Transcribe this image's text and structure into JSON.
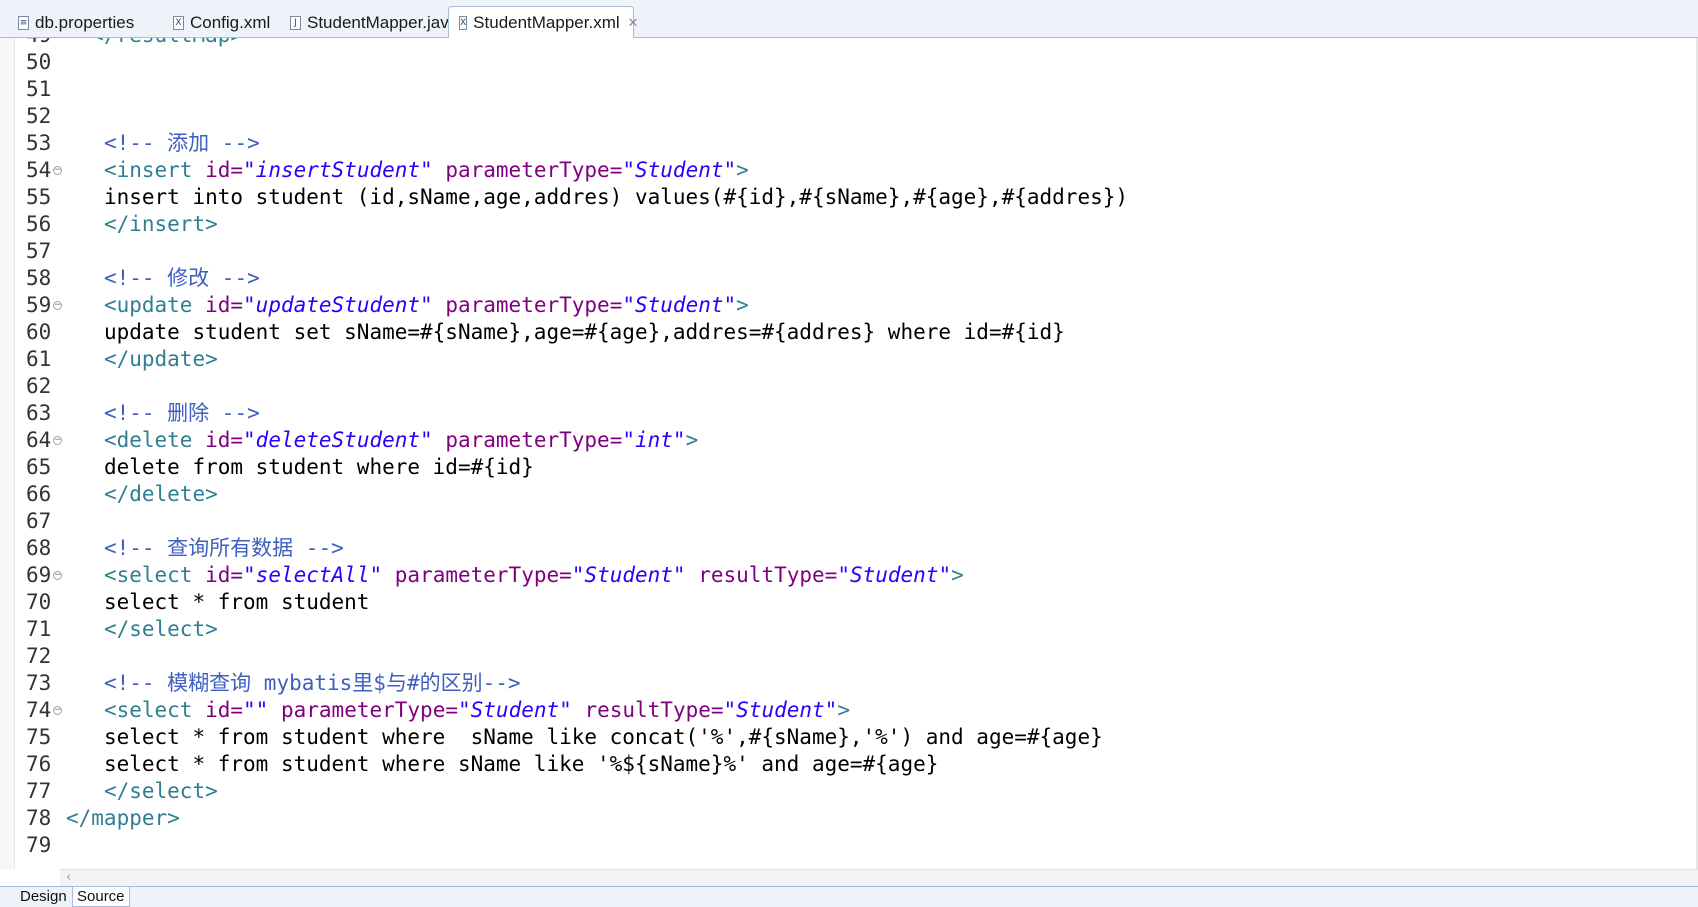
{
  "tabs": [
    {
      "label": "db.properties",
      "icon": "properties-file-icon"
    },
    {
      "label": "Config.xml",
      "icon": "xml-file-icon"
    },
    {
      "label": "StudentMapper.java",
      "icon": "java-file-icon"
    },
    {
      "label": "StudentMapper.xml",
      "icon": "xml-file-icon",
      "active": true,
      "close": "✕"
    }
  ],
  "editor": {
    "lines": [
      {
        "n": "49",
        "fold": false,
        "tokens": [
          [
            "t",
            "</resultMap>"
          ]
        ],
        "indent": 2
      },
      {
        "n": "50",
        "fold": false,
        "tokens": [],
        "indent": 0
      },
      {
        "n": "51",
        "fold": false,
        "tokens": [],
        "indent": 0
      },
      {
        "n": "52",
        "fold": false,
        "tokens": [],
        "indent": 0
      },
      {
        "n": "53",
        "fold": false,
        "tokens": [
          [
            "c",
            "<!-- 添加 -->"
          ]
        ],
        "indent": 3
      },
      {
        "n": "54",
        "fold": true,
        "tokens": [
          [
            "t",
            "<insert "
          ],
          [
            "a",
            "id="
          ],
          [
            "v",
            "\"insertStudent\""
          ],
          [
            "x",
            " "
          ],
          [
            "a",
            "parameterType="
          ],
          [
            "v",
            "\"Student\""
          ],
          [
            "t",
            ">"
          ]
        ],
        "indent": 3
      },
      {
        "n": "55",
        "fold": false,
        "tokens": [
          [
            "x",
            "insert into student (id,sName,age,addres) values(#{id},#{sName},#{age},#{addres})"
          ]
        ],
        "indent": 3
      },
      {
        "n": "56",
        "fold": false,
        "tokens": [
          [
            "t",
            "</insert>"
          ]
        ],
        "indent": 3
      },
      {
        "n": "57",
        "fold": false,
        "tokens": [],
        "indent": 0
      },
      {
        "n": "58",
        "fold": false,
        "tokens": [
          [
            "c",
            "<!-- 修改 -->"
          ]
        ],
        "indent": 3
      },
      {
        "n": "59",
        "fold": true,
        "tokens": [
          [
            "t",
            "<update "
          ],
          [
            "a",
            "id="
          ],
          [
            "v",
            "\"updateStudent\""
          ],
          [
            "x",
            " "
          ],
          [
            "a",
            "parameterType="
          ],
          [
            "v",
            "\"Student\""
          ],
          [
            "t",
            ">"
          ]
        ],
        "indent": 3
      },
      {
        "n": "60",
        "fold": false,
        "tokens": [
          [
            "x",
            "update student set sName=#{sName},age=#{age},addres=#{addres} where id=#{id}"
          ]
        ],
        "indent": 3
      },
      {
        "n": "61",
        "fold": false,
        "tokens": [
          [
            "t",
            "</update>"
          ]
        ],
        "indent": 3
      },
      {
        "n": "62",
        "fold": false,
        "tokens": [],
        "indent": 0
      },
      {
        "n": "63",
        "fold": false,
        "tokens": [
          [
            "c",
            "<!-- 删除 -->"
          ]
        ],
        "indent": 3
      },
      {
        "n": "64",
        "fold": true,
        "tokens": [
          [
            "t",
            "<delete "
          ],
          [
            "a",
            "id="
          ],
          [
            "v",
            "\"deleteStudent\""
          ],
          [
            "x",
            " "
          ],
          [
            "a",
            "parameterType="
          ],
          [
            "v",
            "\"int\""
          ],
          [
            "t",
            ">"
          ]
        ],
        "indent": 3
      },
      {
        "n": "65",
        "fold": false,
        "tokens": [
          [
            "x",
            "delete from student where id=#{id}"
          ]
        ],
        "indent": 3
      },
      {
        "n": "66",
        "fold": false,
        "tokens": [
          [
            "t",
            "</delete>"
          ]
        ],
        "indent": 3
      },
      {
        "n": "67",
        "fold": false,
        "tokens": [],
        "indent": 0
      },
      {
        "n": "68",
        "fold": false,
        "tokens": [
          [
            "c",
            "<!-- 查询所有数据 -->"
          ]
        ],
        "indent": 3
      },
      {
        "n": "69",
        "fold": true,
        "tokens": [
          [
            "t",
            "<select "
          ],
          [
            "a",
            "id="
          ],
          [
            "v",
            "\"selectAll\""
          ],
          [
            "x",
            " "
          ],
          [
            "a",
            "parameterType="
          ],
          [
            "v",
            "\"Student\""
          ],
          [
            "x",
            " "
          ],
          [
            "a",
            "resultType="
          ],
          [
            "v",
            "\"Student\""
          ],
          [
            "t",
            ">"
          ]
        ],
        "indent": 3
      },
      {
        "n": "70",
        "fold": false,
        "tokens": [
          [
            "x",
            "select * from student"
          ]
        ],
        "indent": 3
      },
      {
        "n": "71",
        "fold": false,
        "tokens": [
          [
            "t",
            "</select>"
          ]
        ],
        "indent": 3
      },
      {
        "n": "72",
        "fold": false,
        "tokens": [],
        "indent": 0
      },
      {
        "n": "73",
        "fold": false,
        "tokens": [
          [
            "c",
            "<!-- 模糊查询 mybatis里$与#的区别-->"
          ]
        ],
        "indent": 3
      },
      {
        "n": "74",
        "fold": true,
        "tokens": [
          [
            "t",
            "<select "
          ],
          [
            "a",
            "id="
          ],
          [
            "v",
            "\"\""
          ],
          [
            "x",
            " "
          ],
          [
            "a",
            "parameterType="
          ],
          [
            "v",
            "\"Student\""
          ],
          [
            "x",
            " "
          ],
          [
            "a",
            "resultType="
          ],
          [
            "v",
            "\"Student\""
          ],
          [
            "t",
            ">"
          ]
        ],
        "indent": 3
      },
      {
        "n": "75",
        "fold": false,
        "tokens": [
          [
            "x",
            "select * from student where  sName like concat('%',#{sName},'%') and age=#{age}"
          ]
        ],
        "indent": 3
      },
      {
        "n": "76",
        "fold": false,
        "tokens": [
          [
            "x",
            "select * from student where sName like '%${sName}%' and age=#{age}"
          ]
        ],
        "indent": 3
      },
      {
        "n": "77",
        "fold": false,
        "tokens": [
          [
            "t",
            "</select>"
          ]
        ],
        "indent": 3
      },
      {
        "n": "78",
        "fold": false,
        "tokens": [
          [
            "t",
            "</mapper>"
          ]
        ],
        "indent": 0
      },
      {
        "n": "79",
        "fold": false,
        "tokens": [],
        "indent": 0
      }
    ]
  },
  "scrollbar": {
    "left_arrow": "‹"
  },
  "bottom_tabs": {
    "design": "Design",
    "source": "Source"
  }
}
